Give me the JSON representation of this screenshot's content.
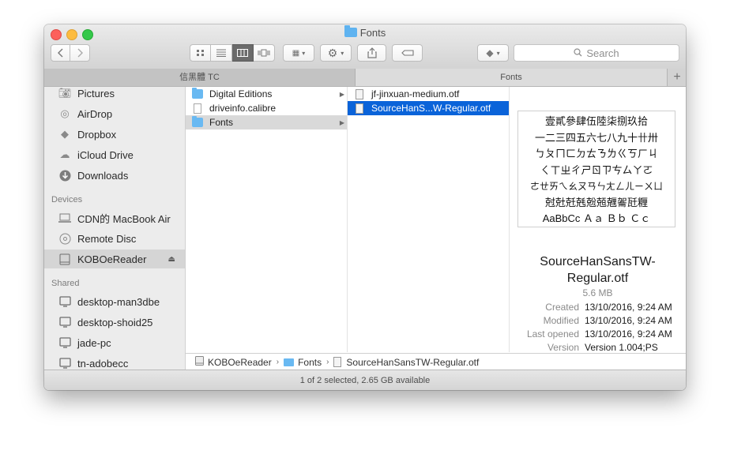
{
  "window": {
    "title": "Fonts"
  },
  "toolbar": {
    "search_placeholder": "Search",
    "back_icon": "chevron-left-icon",
    "forward_icon": "chevron-right-icon"
  },
  "tabs": [
    {
      "label": "信黑體 TC"
    },
    {
      "label": "Fonts"
    }
  ],
  "sidebar": {
    "favorites": [
      {
        "label": "Pictures",
        "icon": "camera-icon"
      },
      {
        "label": "AirDrop",
        "icon": "airdrop-icon"
      },
      {
        "label": "Dropbox",
        "icon": "dropbox-icon"
      },
      {
        "label": "iCloud Drive",
        "icon": "cloud-icon"
      },
      {
        "label": "Downloads",
        "icon": "download-icon"
      }
    ],
    "devices_header": "Devices",
    "devices": [
      {
        "label": "CDN的 MacBook Air",
        "icon": "laptop-icon"
      },
      {
        "label": "Remote Disc",
        "icon": "disc-icon"
      },
      {
        "label": "KOBOeReader",
        "icon": "drive-icon"
      }
    ],
    "shared_header": "Shared",
    "shared": [
      {
        "label": "desktop-man3dbe",
        "icon": "monitor-icon"
      },
      {
        "label": "desktop-shoid25",
        "icon": "monitor-icon"
      },
      {
        "label": "jade-pc",
        "icon": "monitor-icon"
      },
      {
        "label": "tn-adobecc",
        "icon": "monitor-icon"
      }
    ]
  },
  "columns": {
    "col1": [
      {
        "label": "Digital Editions"
      },
      {
        "label": "driveinfo.calibre"
      },
      {
        "label": "Fonts"
      }
    ],
    "col2": [
      {
        "label": "jf-jinxuan-medium.otf"
      },
      {
        "label": "SourceHanS...W-Regular.otf"
      }
    ]
  },
  "preview": {
    "glyph_lines": [
      "壹貳參肆伍陸柒捌玖拾",
      "一二三四五六七八九十卄卅",
      "ㄅㄆㄇㄈㄉㄊㄋㄌㄍㄎㄏㄐ",
      "ㄑㄒㄓㄔㄕㄖㄗㄘㄙㄚㄛ",
      "ㄜㄝㄞㄟㄠㄡㄢㄣㄤㄥㄦㄧㄨㄩ",
      "尅兙兛兞兝兡兣嗧瓩糎",
      "AaBbCc Ａａ Ｂｂ Ｃｃ"
    ],
    "name": "SourceHanSansTW-Regular.otf",
    "size": "5.6 MB",
    "meta": [
      {
        "key": "Created",
        "value": "13/10/2016, 9:24 AM"
      },
      {
        "key": "Modified",
        "value": "13/10/2016, 9:24 AM"
      },
      {
        "key": "Last opened",
        "value": "13/10/2016, 9:24 AM"
      },
      {
        "key": "Version",
        "value": "Version 1.004;PS"
      }
    ]
  },
  "pathbar": [
    {
      "label": "KOBOeReader"
    },
    {
      "label": "Fonts"
    },
    {
      "label": "SourceHanSansTW-Regular.otf"
    }
  ],
  "status": "1 of 2 selected, 2.65 GB available",
  "colors": {
    "selection": "#0a63d9",
    "folder": "#69b9f2"
  }
}
